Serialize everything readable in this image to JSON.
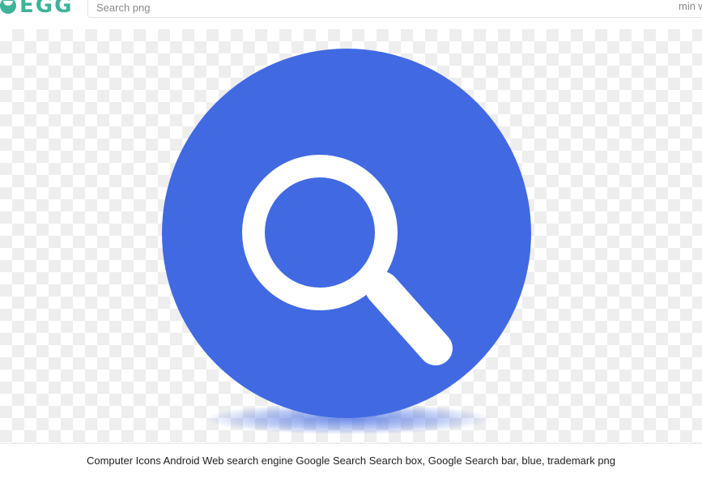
{
  "header": {
    "logo_text": "EGG",
    "search": {
      "placeholder": "Search png",
      "value": ""
    },
    "size_filter_label": "min w"
  },
  "image": {
    "icon": "search-magnifier-icon",
    "colors": {
      "circle": "#4169e1",
      "glyph": "#ffffff",
      "checker_light": "#ffffff",
      "checker_dark": "#eeeeee"
    }
  },
  "caption": {
    "text": "Computer Icons Android Web search engine Google Search Search box, Google Search bar, blue, trademark png"
  }
}
